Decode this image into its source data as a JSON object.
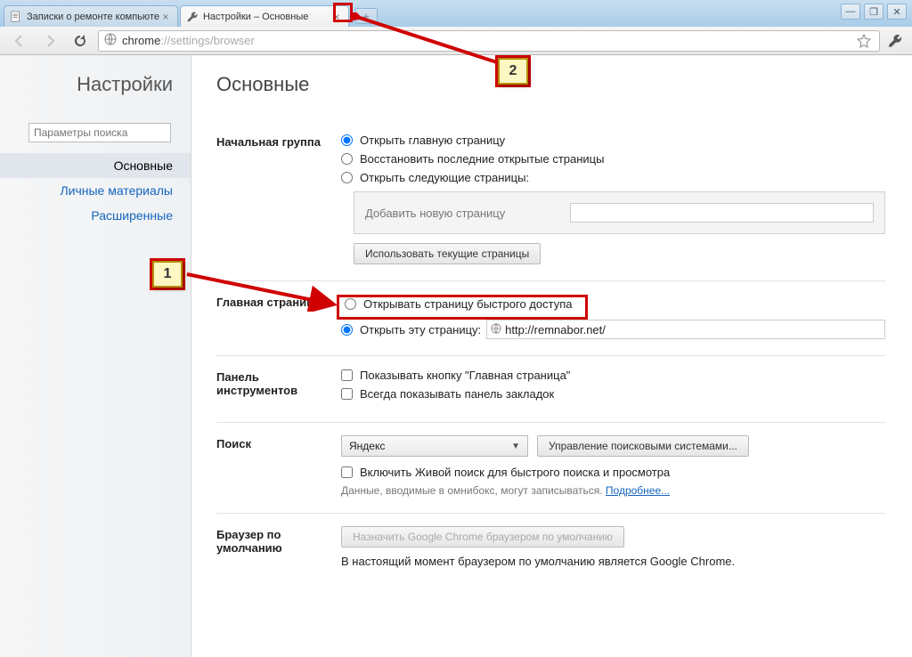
{
  "window": {
    "tabs": [
      {
        "title": "Записки о ремонте компьюте",
        "icon": "page-icon"
      },
      {
        "title": "Настройки – Основные",
        "icon": "wrench-icon"
      }
    ],
    "new_tab_tooltip": "+",
    "controls": {
      "min": "—",
      "max": "❐",
      "close": "✕"
    }
  },
  "toolbar": {
    "url_prefix": "chrome",
    "url_mid": "://settings/",
    "url_suffix": "browser"
  },
  "sidebar": {
    "title": "Настройки",
    "search_placeholder": "Параметры поиска",
    "items": [
      {
        "label": "Основные",
        "active": true
      },
      {
        "label": "Личные материалы",
        "active": false
      },
      {
        "label": "Расширенные",
        "active": false
      }
    ]
  },
  "main": {
    "title": "Основные",
    "startup": {
      "label": "Начальная группа",
      "opt1": "Открыть главную страницу",
      "opt2": "Восстановить последние открытые страницы",
      "opt3": "Открыть следующие страницы:",
      "add_page": "Добавить новую страницу",
      "use_current": "Использовать текущие страницы"
    },
    "home": {
      "label": "Главная страница",
      "opt1": "Открывать страницу быстрого доступа",
      "opt2": "Открыть эту страницу:",
      "url": "http://remnabor.net/"
    },
    "toolbar_panel": {
      "label": "Панель инструментов",
      "chk1": "Показывать кнопку \"Главная страница\"",
      "chk2": "Всегда показывать панель закладок"
    },
    "search": {
      "label": "Поиск",
      "engine": "Яндекс",
      "manage_btn": "Управление поисковыми системами...",
      "instant_chk": "Включить Живой поиск для быстрого поиска и просмотра",
      "note": "Данные, вводимые в омнибокс, могут записываться.",
      "note_link": "Подробнее..."
    },
    "default_browser": {
      "label": "Браузер по умолчанию",
      "btn": "Назначить Google Chrome браузером по умолчанию",
      "status": "В настоящий момент браузером по умолчанию является Google Chrome."
    }
  },
  "annotations": {
    "callout1": "1",
    "callout2": "2"
  }
}
